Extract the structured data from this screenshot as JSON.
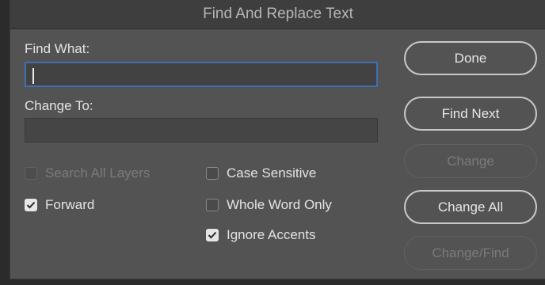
{
  "dialog": {
    "title": "Find And Replace Text",
    "find_label": "Find What:",
    "find_value": "",
    "change_label": "Change To:",
    "change_value": ""
  },
  "options": {
    "search_all_layers": {
      "label": "Search All Layers",
      "checked": false,
      "enabled": false
    },
    "forward": {
      "label": "Forward",
      "checked": true,
      "enabled": true
    },
    "case_sensitive": {
      "label": "Case Sensitive",
      "checked": false,
      "enabled": true
    },
    "whole_word_only": {
      "label": "Whole Word Only",
      "checked": false,
      "enabled": true
    },
    "ignore_accents": {
      "label": "Ignore Accents",
      "checked": true,
      "enabled": true
    }
  },
  "buttons": {
    "done": "Done",
    "find_next": "Find Next",
    "change": "Change",
    "change_all": "Change All",
    "change_find": "Change/Find"
  },
  "colors": {
    "dialog_bg": "#535353",
    "focus_ring": "#3f6fb5"
  }
}
